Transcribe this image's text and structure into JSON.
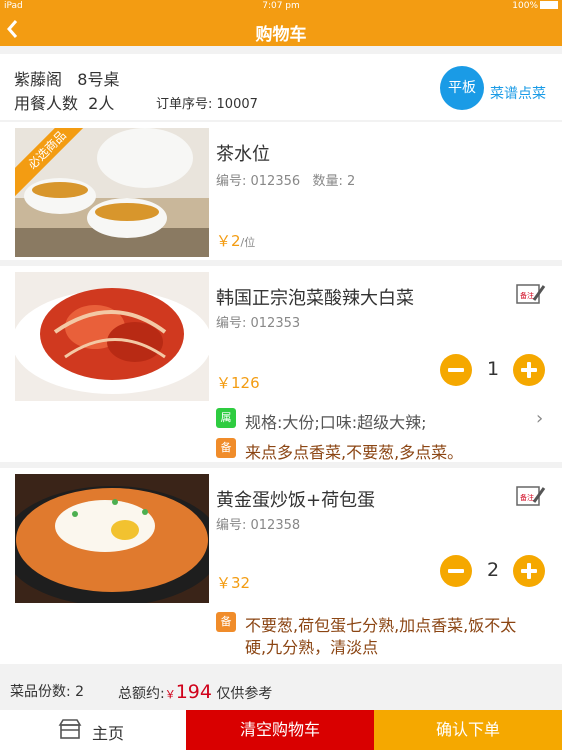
{
  "status_bar": {
    "carrier": "iPad",
    "time": "7:07 pm",
    "battery": "100%"
  },
  "nav": {
    "title": "购物车"
  },
  "table_info": {
    "line1": "紫藤阁   8号桌",
    "line2": "用餐人数  2人",
    "order_label": "订单序号:",
    "order_no": "10007",
    "tablet_button": "平板",
    "menu_link": "菜谱点菜"
  },
  "items": [
    {
      "ribbon": "必选商品",
      "name": "茶水位",
      "code": "编号: 012356   数量: 2",
      "price": "￥2",
      "unit": "/位"
    },
    {
      "name": "韩国正宗泡菜酸辣大白菜",
      "code": "编号: 012353",
      "price": "￥126",
      "qty": "1",
      "attr_tag": "属",
      "attr": "规格:大份;口味:超级大辣;",
      "note_tag": "备",
      "note": "来点多点香菜,不要葱,多点菜。",
      "note_icon_label": "备注"
    },
    {
      "name": "黄金蛋炒饭+荷包蛋",
      "code": "编号: 012358",
      "price": "￥32",
      "qty": "2",
      "note_tag": "备",
      "note_line1": "不要葱,荷包蛋七分熟,加点香菜,饭不太",
      "note_line2": "硬,九分熟，清淡点",
      "note_icon_label": "备注"
    }
  ],
  "summary": {
    "count_label": "菜品份数:",
    "count": "2",
    "total_label": "总额约:",
    "yen": "￥",
    "total": "194",
    "ref": "仅供参考"
  },
  "bottom": {
    "home": "主页",
    "clear": "清空购物车",
    "confirm": "确认下单"
  },
  "colors": {
    "accent": "#f39c12",
    "blue": "#1a9be6",
    "red": "#d90000"
  }
}
